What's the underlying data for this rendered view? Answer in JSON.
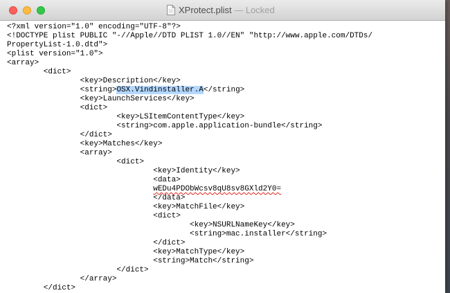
{
  "window": {
    "title": "XProtect.plist",
    "title_separator": "—",
    "title_state": "Locked",
    "buttons": {
      "close": "close-button",
      "minimize": "minimize-button",
      "zoom": "zoom-button"
    },
    "document_icon": "document-icon"
  },
  "colors": {
    "selection": "#b3d7ff",
    "spell_underline": "#e0201b",
    "close": "#fc605c",
    "minimize": "#fdbc40",
    "zoom": "#34c84a"
  },
  "editor": {
    "lines": [
      "<?xml version=\"1.0\" encoding=\"UTF-8\"?>",
      "<!DOCTYPE plist PUBLIC \"-//Apple//DTD PLIST 1.0//EN\" \"http://www.apple.com/DTDs/",
      "PropertyList-1.0.dtd\">",
      "<plist version=\"1.0\">",
      "<array>",
      "        <dict>",
      "                <key>Description</key>",
      "                <string>",
      "                <key>LaunchServices</key>",
      "                <dict>",
      "                        <key>LSItemContentType</key>",
      "                        <string>com.apple.application-bundle</string>",
      "                </dict>",
      "                <key>Matches</key>",
      "                <array>",
      "                        <dict>",
      "                                <key>Identity</key>",
      "                                <data>",
      "                                ",
      "                                </data>",
      "                                <key>MatchFile</key>",
      "                                <dict>",
      "                                        <key>NSURLNameKey</key>",
      "                                        <string>mac.installer</string>",
      "                                </dict>",
      "                                <key>MatchType</key>",
      "                                <string>Match</string>",
      "                        </dict>",
      "                </array>",
      "        </dict>"
    ],
    "selected_text": "OSX.Vindinstaller.A",
    "after_selection": "</string>",
    "misspelled_text": "wEDu4PDObWcsv8qU8sv8GXld2Y0=",
    "after_misspelled": ""
  }
}
